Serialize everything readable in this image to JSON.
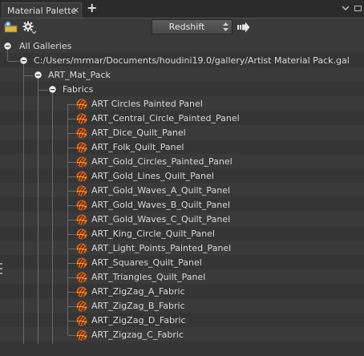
{
  "tab": {
    "title": "Material Palette",
    "close": "×",
    "add": "+"
  },
  "toolbar": {
    "renderer": "Redshift"
  },
  "tree": {
    "root": "All Galleries",
    "gallery": "C:/Users/mrmar/Documents/houdini19.0/gallery/Artist Material Pack.gal",
    "pack": "ART_Mat_Pack",
    "folder": "Fabrics",
    "materials": [
      "ART Circles Painted Panel",
      "ART_Central_Circle_Painted_Panel",
      "ART_Dice_Quilt_Panel",
      "ART_Folk_Quilt_Panel",
      "ART_Gold_Circles_Painted_Panel",
      "ART_Gold_Lines_Quilt_Panel",
      "ART_Gold_Waves_A_Quilt_Panel",
      "ART_Gold_Waves_B_Quilt_Panel",
      "ART_Gold_Waves_C_Quilt_Panel",
      "ART_King_Circle_Quilt_Panel",
      "ART_Light_Points_Painted_Panel",
      "ART_Squares_Quilt_Panel",
      "ART_Triangles_Quilt_Panel",
      "ART_ZigZag_A_Fabric",
      "ART_ZigZag_B_Fabric",
      "ART_ZigZag_D_Fabric",
      "ART_Zigzag_C_Fabric"
    ]
  },
  "icons": {
    "new_folder": "folder-add-icon",
    "settings": "gear-icon",
    "menu": "chevron-down-icon",
    "go": "arrow-right-icon",
    "material": "material-swatch-icon",
    "expander": "collapse-icon"
  },
  "colors": {
    "background": "#3a3a3a",
    "accent_orange": "#e0701a",
    "text": "#d8d8d8"
  }
}
